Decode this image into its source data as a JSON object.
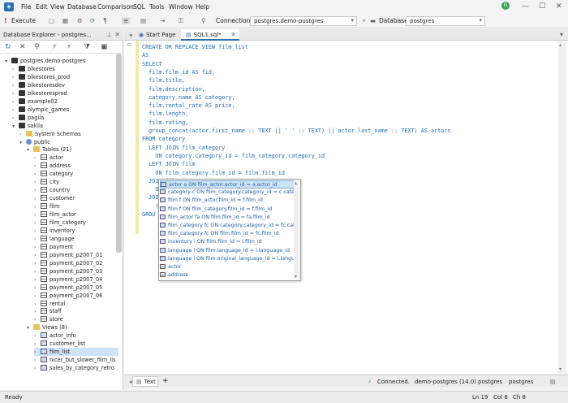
{
  "menu": [
    "File",
    "Edit",
    "View",
    "Database",
    "Comparison",
    "SQL",
    "Tools",
    "Window",
    "Help"
  ],
  "toolbar": {
    "execute_label": "Execute",
    "connection_label": "Connection",
    "connection_value": "postgres.demo-postgres",
    "database_label": "Database",
    "database_value": "postgres"
  },
  "left_panel": {
    "title": "Database Explorer - postgres...",
    "tree": [
      {
        "label": "postgres.demo-postgres",
        "level": 0,
        "icon": "connection",
        "tw": "▾"
      },
      {
        "label": "bikestores",
        "level": 1,
        "icon": "db",
        "tw": "›"
      },
      {
        "label": "bikestores_prod",
        "level": 1,
        "icon": "db",
        "tw": "›"
      },
      {
        "label": "bikestoresdev",
        "level": 1,
        "icon": "db",
        "tw": "›"
      },
      {
        "label": "bikestoresprod",
        "level": 1,
        "icon": "db",
        "tw": "›"
      },
      {
        "label": "example02",
        "level": 1,
        "icon": "db",
        "tw": "›"
      },
      {
        "label": "olympic_games",
        "level": 1,
        "icon": "db",
        "tw": "›"
      },
      {
        "label": "pagila",
        "level": 1,
        "icon": "db",
        "tw": "›"
      },
      {
        "label": "sakila",
        "level": 1,
        "icon": "db",
        "tw": "▾"
      },
      {
        "label": "System Schemas",
        "level": 2,
        "icon": "folder",
        "tw": "›"
      },
      {
        "label": "public",
        "level": 2,
        "icon": "schema",
        "tw": "▾"
      },
      {
        "label": "Tables (21)",
        "level": 3,
        "icon": "folder",
        "tw": "▾"
      },
      {
        "label": "actor",
        "level": 4,
        "icon": "table",
        "tw": "›"
      },
      {
        "label": "address",
        "level": 4,
        "icon": "table",
        "tw": "›"
      },
      {
        "label": "category",
        "level": 4,
        "icon": "table",
        "tw": "›"
      },
      {
        "label": "city",
        "level": 4,
        "icon": "table",
        "tw": "›"
      },
      {
        "label": "country",
        "level": 4,
        "icon": "table",
        "tw": "›"
      },
      {
        "label": "customer",
        "level": 4,
        "icon": "table",
        "tw": "›"
      },
      {
        "label": "film",
        "level": 4,
        "icon": "table",
        "tw": "›"
      },
      {
        "label": "film_actor",
        "level": 4,
        "icon": "table",
        "tw": "›"
      },
      {
        "label": "film_category",
        "level": 4,
        "icon": "table",
        "tw": "›"
      },
      {
        "label": "inventory",
        "level": 4,
        "icon": "table",
        "tw": "›"
      },
      {
        "label": "language",
        "level": 4,
        "icon": "table",
        "tw": "›"
      },
      {
        "label": "payment",
        "level": 4,
        "icon": "table",
        "tw": "›"
      },
      {
        "label": "payment_p2007_01",
        "level": 4,
        "icon": "table",
        "tw": "›"
      },
      {
        "label": "payment_p2007_02",
        "level": 4,
        "icon": "table",
        "tw": "›"
      },
      {
        "label": "payment_p2007_03",
        "level": 4,
        "icon": "table",
        "tw": "›"
      },
      {
        "label": "payment_p2007_04",
        "level": 4,
        "icon": "table",
        "tw": "›"
      },
      {
        "label": "payment_p2007_05",
        "level": 4,
        "icon": "table",
        "tw": "›"
      },
      {
        "label": "payment_p2007_06",
        "level": 4,
        "icon": "table",
        "tw": "›"
      },
      {
        "label": "rental",
        "level": 4,
        "icon": "table",
        "tw": "›"
      },
      {
        "label": "staff",
        "level": 4,
        "icon": "table",
        "tw": "›"
      },
      {
        "label": "store",
        "level": 4,
        "icon": "table",
        "tw": "›"
      },
      {
        "label": "Views (8)",
        "level": 3,
        "icon": "folder",
        "tw": "▾"
      },
      {
        "label": "actor_info",
        "level": 4,
        "icon": "view",
        "tw": "›"
      },
      {
        "label": "customer_list",
        "level": 4,
        "icon": "view",
        "tw": "›"
      },
      {
        "label": "film_list",
        "level": 4,
        "icon": "view",
        "tw": "›",
        "selected": true
      },
      {
        "label": "nicer_but_slower_film_lis",
        "level": 4,
        "icon": "view",
        "tw": "›"
      },
      {
        "label": "sales_by_category_retro",
        "level": 4,
        "icon": "view",
        "tw": "›"
      }
    ]
  },
  "tabs": [
    {
      "label": "Start Page"
    },
    {
      "label": "SQL1.sql*",
      "active": true
    }
  ],
  "code_lines": [
    "CREATE OR REPLACE VIEW film_list",
    "AS",
    "SELECT",
    "  film.film_id AS fid,",
    "  film.title,",
    "  film.description,",
    "  category.name AS category,",
    "  film.rental_rate AS price,",
    "  film.length,",
    "  film.rating,",
    "  group_concat(actor.first_name :: TEXT || ' ' :: TEXT) || actor.last_name :: TEXT) AS actors",
    "FROM category",
    "  LEFT JOIN film_category",
    "    ON category.category_id = film_category.category_id",
    "  LEFT JOIN film",
    "    ON film_category.film_id = film.film_id",
    "  JOIN film_actor",
    "    ON film.film_id = film_actor.film_id",
    "  JOIN actor",
    "    (",
    "GROU"
  ],
  "autocomplete": [
    {
      "text": "actor a ON film_actor.actor_id = a.actor_id",
      "icon": "join",
      "selected": true
    },
    {
      "text": "category c ON film_category.category_id = c.category",
      "icon": "join"
    },
    {
      "text": "film f ON film_actor.film_id = f.film_id",
      "icon": "join"
    },
    {
      "text": "film f ON film_category.film_id = f.film_id",
      "icon": "join"
    },
    {
      "text": "film_actor fa ON film.film_id = fa.film_id",
      "icon": "join"
    },
    {
      "text": "film_category fc ON category.category_id = fc.categor",
      "icon": "join"
    },
    {
      "text": "film_category fc ON film.film_id = fc.film_id",
      "icon": "join"
    },
    {
      "text": "inventory i ON film.film_id = i.film_id",
      "icon": "join"
    },
    {
      "text": "language l ON film.language_id = l.language_id",
      "icon": "join"
    },
    {
      "text": "language l ON film.original_language_id = l.language_id",
      "icon": "join"
    },
    {
      "text": "actor",
      "icon": "table"
    },
    {
      "text": "address",
      "icon": "table"
    }
  ],
  "bottom_tabs": {
    "text_label": "Text",
    "add_label": "+"
  },
  "connection_status": {
    "state": "Connected.",
    "server": "demo-postgres (14.0)",
    "user": "postgres",
    "database": "postgres"
  },
  "status": {
    "ready": "Ready",
    "line": "Ln 19",
    "col": "Col 8",
    "ch": "Ch 8"
  },
  "colors": {
    "accent": "#2a6fb0",
    "selection": "#cfe3f7",
    "keyword": "#1f3fbf",
    "status_ok": "#3aa655"
  }
}
